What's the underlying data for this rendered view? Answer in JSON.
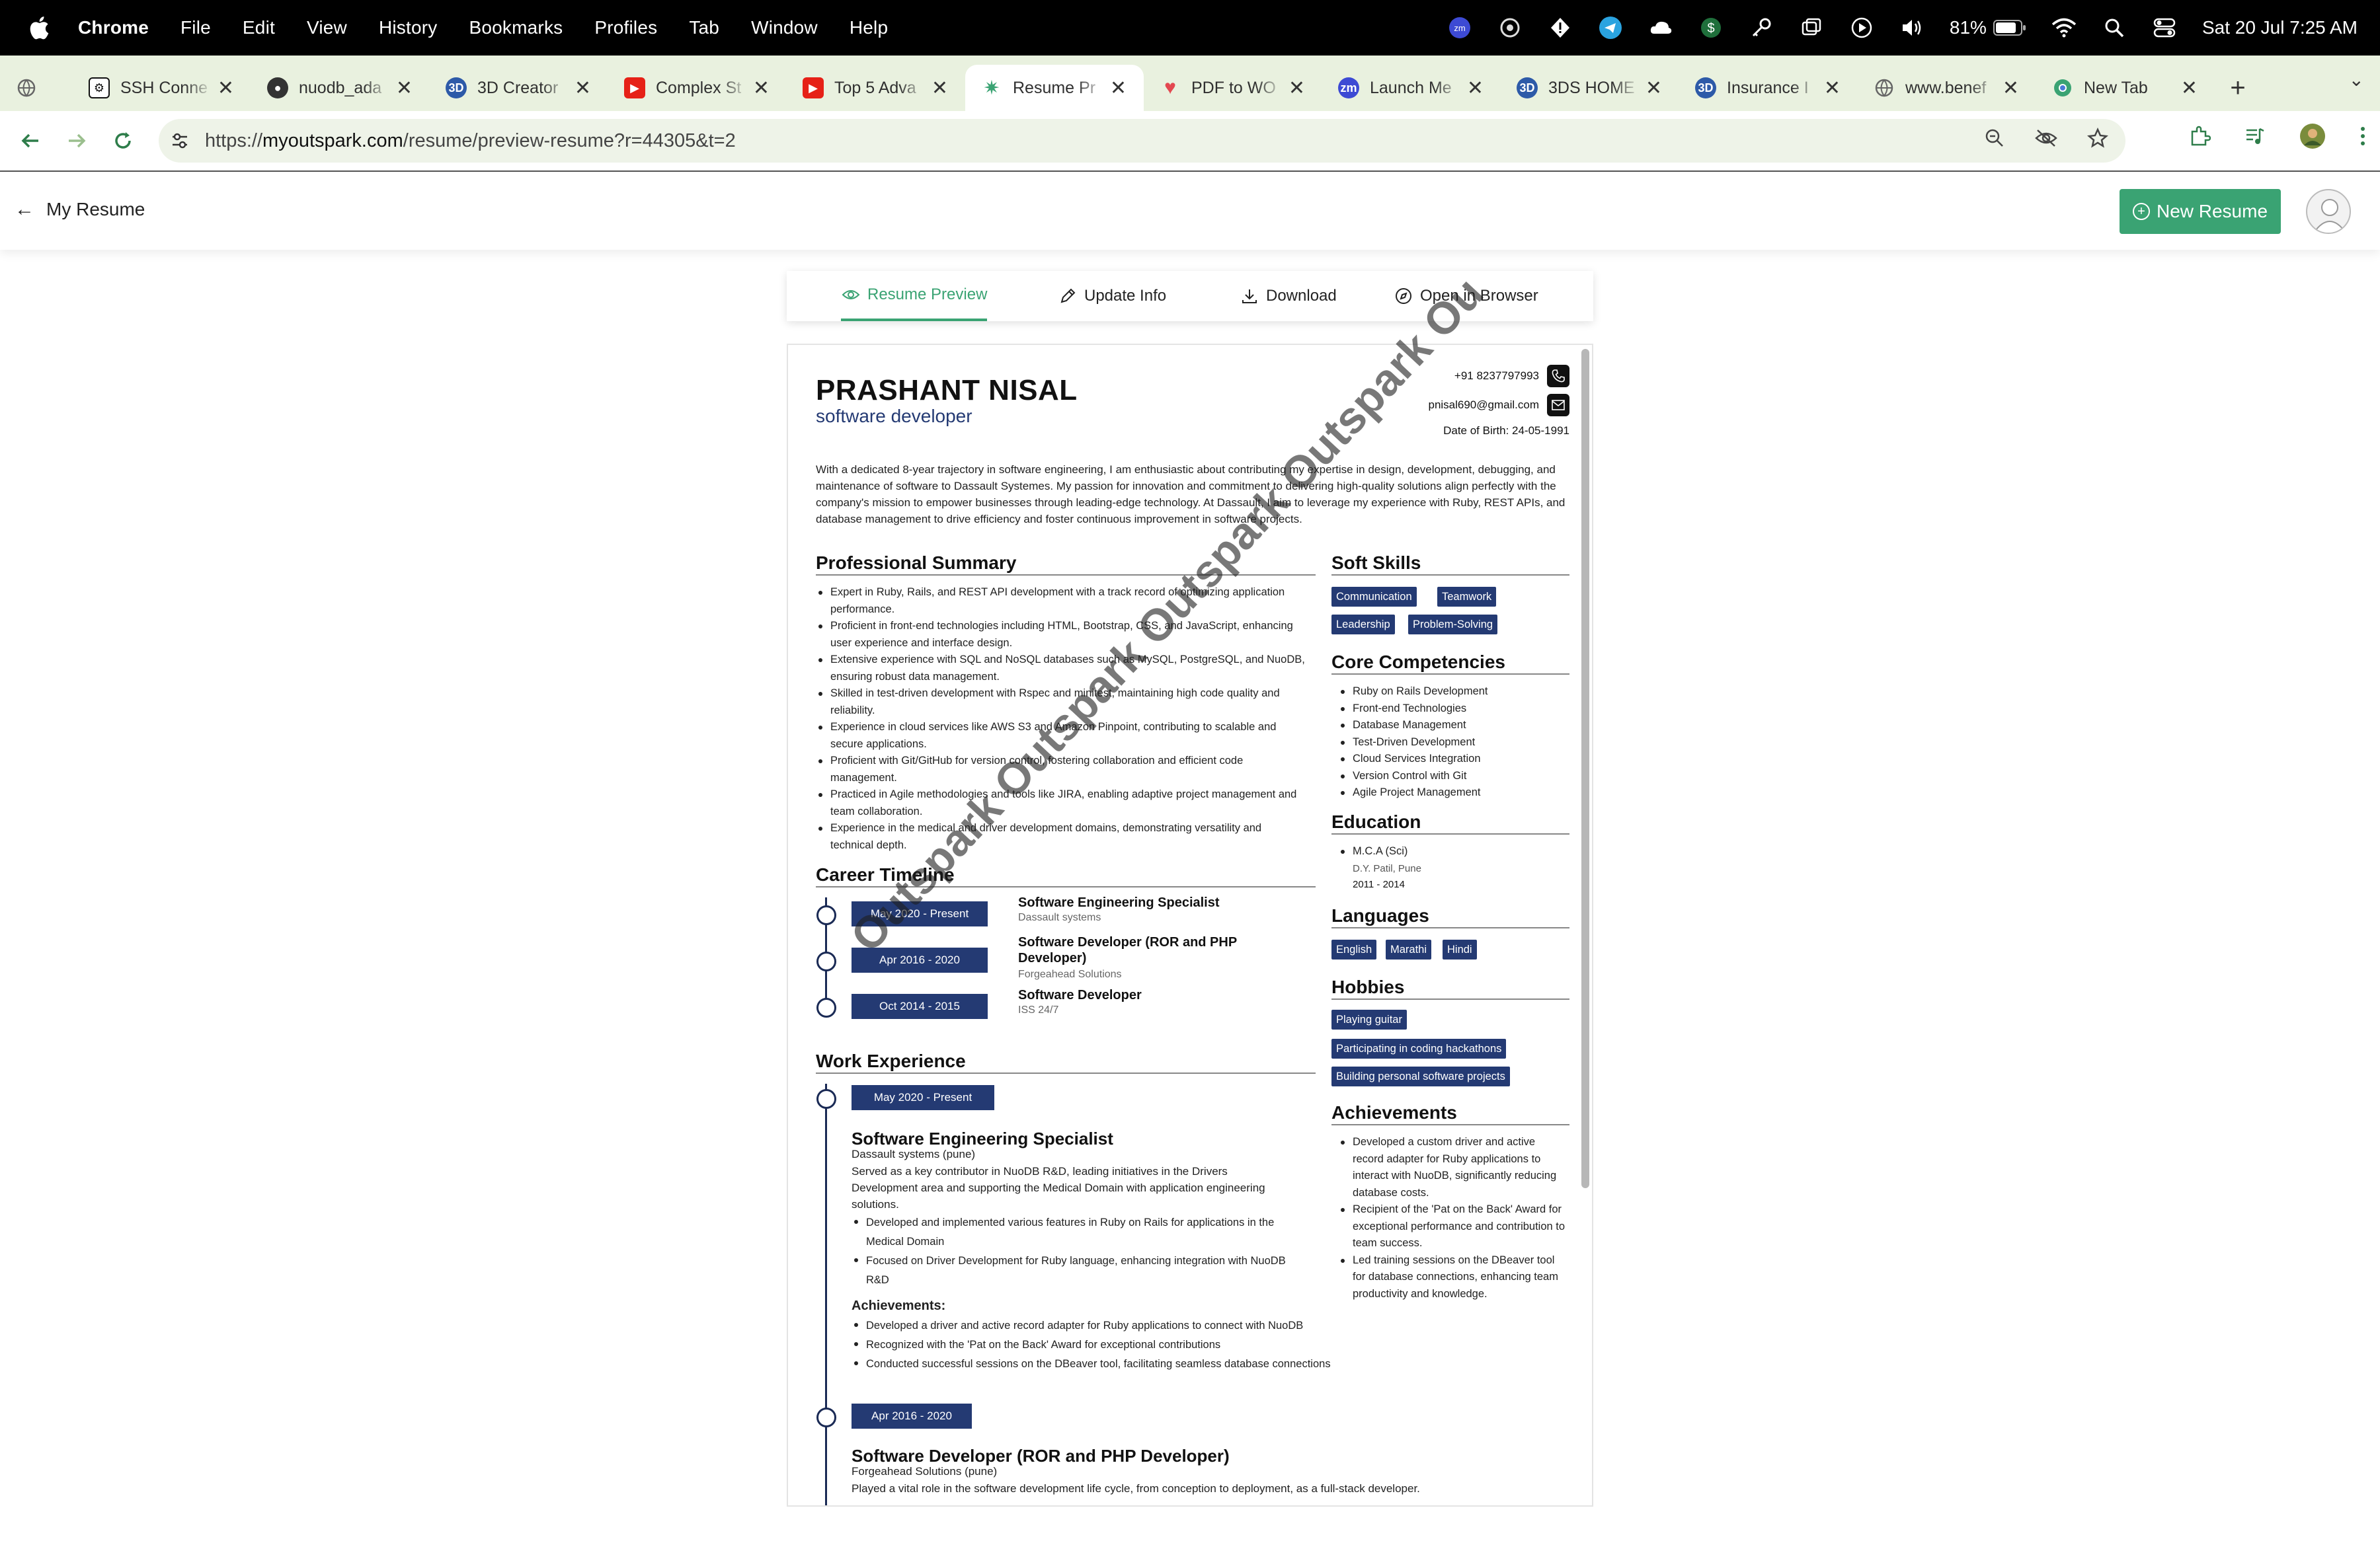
{
  "menubar": {
    "app": "Chrome",
    "items": [
      "File",
      "Edit",
      "View",
      "History",
      "Bookmarks",
      "Profiles",
      "Tab",
      "Window",
      "Help"
    ],
    "battery": "81%",
    "datetime": "Sat 20 Jul  7:25 AM"
  },
  "tabs": [
    {
      "title": "SSH Conne",
      "icon": "openai-icon",
      "color": "#111111"
    },
    {
      "title": "nuodb_ada",
      "icon": "github-icon",
      "color": "#333333"
    },
    {
      "title": "3D Creator",
      "icon": "3ds-icon",
      "color": "#2d5aa8"
    },
    {
      "title": "Complex St",
      "icon": "youtube-icon",
      "color": "#e62117"
    },
    {
      "title": "Top 5 Adva",
      "icon": "youtube-icon",
      "color": "#e62117"
    },
    {
      "title": "Resume Pr",
      "icon": "outspark-icon",
      "color": "#3aa373",
      "active": true
    },
    {
      "title": "PDF to WO",
      "icon": "pdf-heart-icon",
      "color": "#e34850"
    },
    {
      "title": "Launch Me",
      "icon": "zoom-icon",
      "color": "#3d4ad4"
    },
    {
      "title": "3DS HOME",
      "icon": "3ds-icon",
      "color": "#2d5aa8"
    },
    {
      "title": "Insurance I",
      "icon": "3ds-icon",
      "color": "#2d5aa8"
    },
    {
      "title": "www.benef",
      "icon": "globe-icon",
      "color": "#6b6b6b"
    },
    {
      "title": "New Tab",
      "icon": "chrome-icon",
      "color": "#3aa373"
    }
  ],
  "address": {
    "prefix": "https://",
    "domain": "myoutspark.com",
    "path": "/resume/preview-resume?r=44305&t=2"
  },
  "app": {
    "back_label": "My Resume",
    "new_resume_label": "New Resume",
    "accent": "#3aa373"
  },
  "actions": {
    "preview": "Resume Preview",
    "update": "Update Info",
    "download": "Download",
    "open": "Open in Browser"
  },
  "resume": {
    "name": "PRASHANT NISAL",
    "role": "software developer",
    "phone": "+91 8237797993",
    "email": "pnisal690@gmail.com",
    "dob": "Date of Birth: 24-05-1991",
    "intro": "With a dedicated 8-year trajectory in software engineering, I am enthusiastic about contributing my expertise in design, development, debugging, and maintenance of software to Dassault Systemes. My passion for innovation and commitment to delivering high-quality solutions align perfectly with the company's mission to empower businesses through leading-edge technology. At Dassault, I aim to leverage my experience with Ruby, REST APIs, and database management to drive efficiency and foster continuous improvement in software projects.",
    "summary_title": "Professional Summary",
    "summary": [
      "Expert in Ruby, Rails, and REST API development with a track record of optimizing application performance.",
      "Proficient in front-end technologies including HTML, Bootstrap, CSS, and JavaScript, enhancing user experience and interface design.",
      "Extensive experience with SQL and NoSQL databases such as MySQL, PostgreSQL, and NuoDB, ensuring robust data management.",
      "Skilled in test-driven development with Rspec and minitest, maintaining high code quality and reliability.",
      "Experience in cloud services like AWS S3 and Amazon Pinpoint, contributing to scalable and secure applications.",
      "Proficient with Git/GitHub for version control, fostering collaboration and efficient code management.",
      "Practiced in Agile methodologies and tools like JIRA, enabling adaptive project management and team collaboration.",
      "Experience in the medical and driver development domains, demonstrating versatility and technical depth."
    ],
    "timeline_title": "Career Timeline",
    "timeline": [
      {
        "period": "May 2020 - Present",
        "title": "Software Engineering Specialist",
        "company": "Dassault systems"
      },
      {
        "period": "Apr 2016 - 2020",
        "title": "Software Developer (ROR and PHP Developer)",
        "company": "Forgeahead Solutions"
      },
      {
        "period": "Oct 2014 - 2015",
        "title": "Software Developer",
        "company": "ISS 24/7"
      }
    ],
    "work_title": "Work Experience",
    "work": [
      {
        "period": "May 2020 - Present",
        "title": "Software Engineering Specialist",
        "company": "Dassault systems (pune)",
        "desc": "Served as a key contributor in NuoDB R&D, leading initiatives in the Drivers Development area and supporting the Medical Domain with application engineering solutions.",
        "bullets": [
          "Developed and implemented various features in Ruby on Rails for applications in the Medical Domain",
          "Focused on Driver Development for Ruby language, enhancing integration with NuoDB R&D"
        ],
        "ach_title": "Achievements:",
        "achievements": [
          "Developed a driver and active record adapter for Ruby applications to connect with NuoDB",
          "Recognized with the 'Pat on the Back' Award for exceptional contributions",
          "Conducted successful sessions on the DBeaver tool, facilitating seamless database connections"
        ]
      },
      {
        "period": "Apr 2016 - 2020",
        "title": "Software Developer (ROR and PHP Developer)",
        "company": "Forgeahead Solutions (pune)",
        "desc": "Played a vital role in the software development life cycle, from conception to deployment, as a full-stack developer."
      }
    ],
    "soft_title": "Soft Skills",
    "soft": [
      "Communication",
      "Teamwork",
      "Leadership",
      "Problem-Solving"
    ],
    "core_title": "Core Competencies",
    "core": [
      "Ruby on Rails Development",
      "Front-end Technologies",
      "Database Management",
      "Test-Driven Development",
      "Cloud Services Integration",
      "Version Control with Git",
      "Agile Project Management"
    ],
    "edu_title": "Education",
    "edu": {
      "degree": "M.C.A (Sci)",
      "school": "D.Y. Patil, Pune",
      "years": "2011 - 2014"
    },
    "lang_title": "Languages",
    "languages": [
      "English",
      "Marathi",
      "Hindi"
    ],
    "hobby_title": "Hobbies",
    "hobbies": [
      "Playing guitar",
      "Participating in coding hackathons",
      "Building personal software projects"
    ],
    "ach_title": "Achievements",
    "achievements": [
      "Developed a custom driver and active record adapter for Ruby applications to interact with NuoDB, significantly reducing database costs.",
      "Recipient of the 'Pat on the Back' Award for exceptional performance and contribution to team success.",
      "Led training sessions on the DBeaver tool for database connections, enhancing team productivity and knowledge."
    ],
    "watermark": "Outspark Outspark Outspark Outspark Ou"
  }
}
